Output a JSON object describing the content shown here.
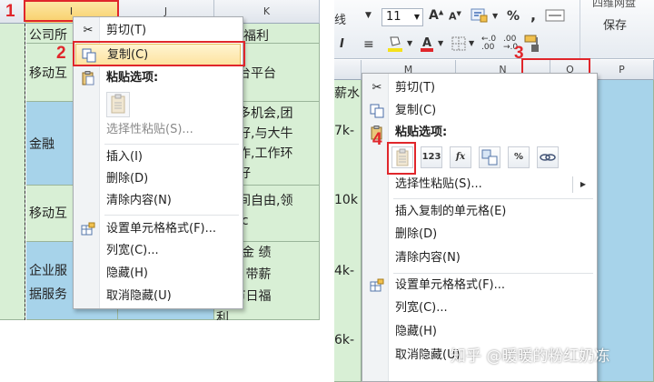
{
  "left": {
    "columns": [
      "I",
      "J",
      "K"
    ],
    "row_labels": [
      "公司所",
      "移动互",
      "金融",
      "移动互",
      "企业服\n据服务"
    ],
    "right_texts": [
      "公福利",
      "台平台",
      "多机会,团\n好,与大牛\n作,工作环\n好",
      "间自由,领\nic",
      "险一金 绩\n奖金 带薪\n假 节日福\n利"
    ],
    "markers": [
      "1",
      "2"
    ],
    "menu": {
      "items": [
        {
          "label": "剪切(T)",
          "icon": "scissors-icon"
        },
        {
          "label": "复制(C)",
          "icon": "copy-icon",
          "highlighted": true
        },
        {
          "label": "粘贴选项:",
          "icon": "paste-icon",
          "bold": true
        },
        {
          "label": "选择性粘贴(S)...",
          "disabled": true
        },
        {
          "label": "插入(I)"
        },
        {
          "label": "删除(D)"
        },
        {
          "label": "清除内容(N)"
        },
        {
          "label": "设置单元格格式(F)...",
          "icon": "format-cells-icon"
        },
        {
          "label": "列宽(C)..."
        },
        {
          "label": "隐藏(H)"
        },
        {
          "label": "取消隐藏(U)"
        }
      ]
    }
  },
  "right": {
    "ribbon": {
      "font_name_tail": "线",
      "font_size": "11",
      "grow_font": "A",
      "shrink_font": "A",
      "percent": "%",
      "comma": ",",
      "bold": "B",
      "italic": "I",
      "save_label": "保存",
      "top_right_label": "四维网盘"
    },
    "columns": [
      "M",
      "N",
      "O",
      "P"
    ],
    "row_labels": [
      "薪水",
      "7k-",
      "10k",
      "4k-",
      "6k-"
    ],
    "markers": [
      "3",
      "4"
    ],
    "menu": {
      "items": [
        {
          "label": "剪切(T)",
          "icon": "scissors-icon"
        },
        {
          "label": "复制(C)",
          "icon": "copy-icon"
        },
        {
          "label": "粘贴选项:",
          "icon": "paste-icon",
          "bold": true
        },
        {
          "label": "选择性粘贴(S)..."
        },
        {
          "label": "插入复制的单元格(E)"
        },
        {
          "label": "删除(D)"
        },
        {
          "label": "清除内容(N)"
        },
        {
          "label": "设置单元格格式(F)...",
          "icon": "format-cells-icon"
        },
        {
          "label": "列宽(C)..."
        },
        {
          "label": "隐藏(H)"
        },
        {
          "label": "取消隐藏(U)"
        }
      ],
      "paste_buttons": [
        "paste-all-icon",
        "123",
        "fx",
        "paste-transpose-icon",
        "%",
        "paste-link-icon"
      ]
    },
    "watermark": "知乎 @暖暖的粉红奶冻"
  },
  "colors": {
    "green_cell": "#d8efd5",
    "blue_cell": "#a7d3ea",
    "highlight_red": "#e0262b",
    "menu_highlight": "#fde3a0"
  }
}
